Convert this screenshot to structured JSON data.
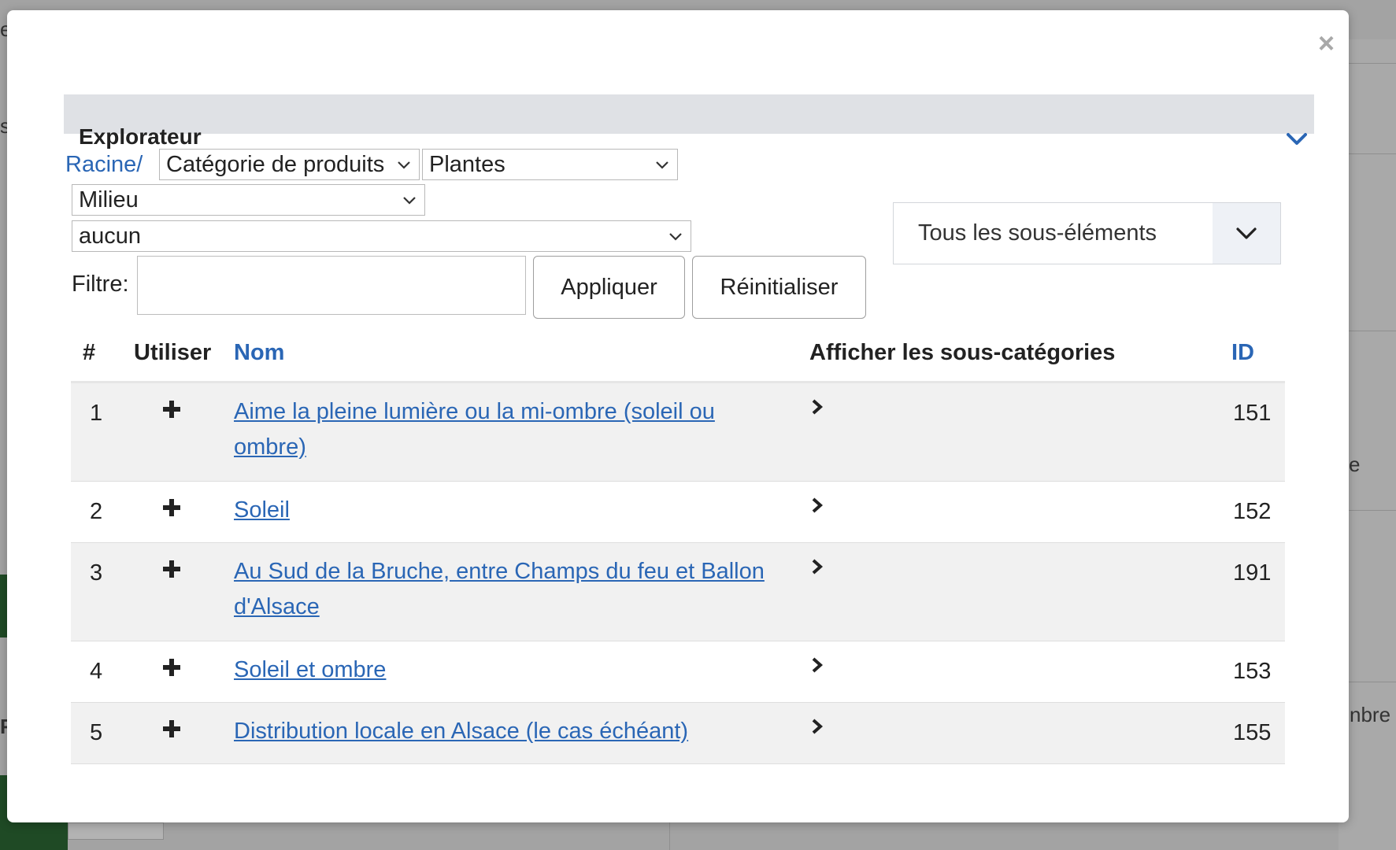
{
  "background": {
    "fragment_left_1": "e",
    "fragment_left_2": "s",
    "fragment_left_3": "F",
    "fragment_right_1": "e",
    "fragment_right_2": "nbre"
  },
  "modal": {
    "close_glyph": "×",
    "panel_title": "Explorateur",
    "breadcrumb_root": "Racine/",
    "select_category": "Catégorie de produits",
    "select_plantes": "Plantes",
    "select_milieu": "Milieu",
    "select_aucun": "aucun",
    "filter_label": "Filtre:",
    "filter_value": "",
    "apply_label": "Appliquer",
    "reset_label": "Réinitialiser",
    "subitems_dropdown": "Tous les sous-éléments"
  },
  "table": {
    "headers": {
      "num": "#",
      "use": "Utiliser",
      "name": "Nom",
      "show_sub": "Afficher les sous-catégories",
      "id": "ID"
    },
    "rows": [
      {
        "num": "1",
        "name": "Aime la pleine lumière ou la mi-ombre (soleil ou ombre)",
        "id": "151"
      },
      {
        "num": "2",
        "name": "Soleil",
        "id": "152"
      },
      {
        "num": "3",
        "name": "Au Sud de la Bruche, entre Champs du feu et Ballon d'Alsace",
        "id": "191"
      },
      {
        "num": "4",
        "name": "Soleil et ombre",
        "id": "153"
      },
      {
        "num": "5",
        "name": "Distribution locale en Alsace (le cas échéant)",
        "id": "155"
      }
    ]
  },
  "colors": {
    "link": "#2a66b5",
    "header_bg": "#dfe1e5",
    "row_alt": "#f1f1f1",
    "overlay": "#9a9a9a"
  },
  "icons": [
    "close-icon",
    "chevron-down-icon",
    "plus-icon",
    "chevron-right-icon"
  ]
}
